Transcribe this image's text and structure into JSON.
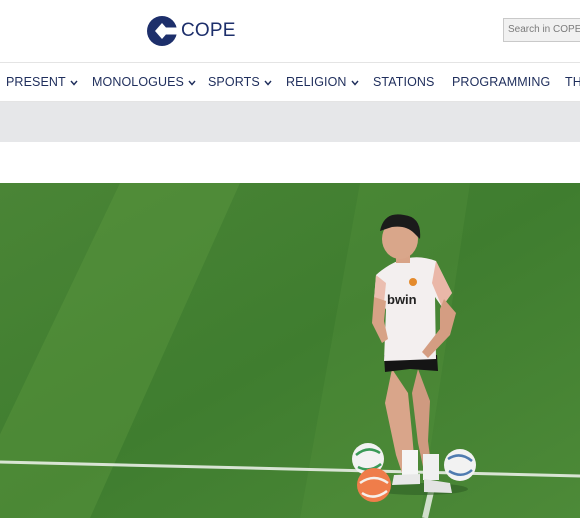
{
  "header": {
    "logo_text": "COPE",
    "search_placeholder": "Search in COPE"
  },
  "nav": {
    "items": [
      {
        "label": "PRESENT",
        "has_dropdown": true
      },
      {
        "label": "MONOLOGUES",
        "has_dropdown": true
      },
      {
        "label": "SPORTS",
        "has_dropdown": true
      },
      {
        "label": "RELIGION",
        "has_dropdown": true
      },
      {
        "label": "STATIONS",
        "has_dropdown": false
      },
      {
        "label": "PROGRAMMING",
        "has_dropdown": false
      },
      {
        "label": "TH",
        "has_dropdown": false
      }
    ]
  },
  "article": {
    "photo_shirt_text": "bwin"
  },
  "colors": {
    "brand_navy": "#1d2f6b",
    "nav_text": "#1f2e5c",
    "ad_bar": "#e6e7e9",
    "pitch": "#4f8a3b"
  }
}
